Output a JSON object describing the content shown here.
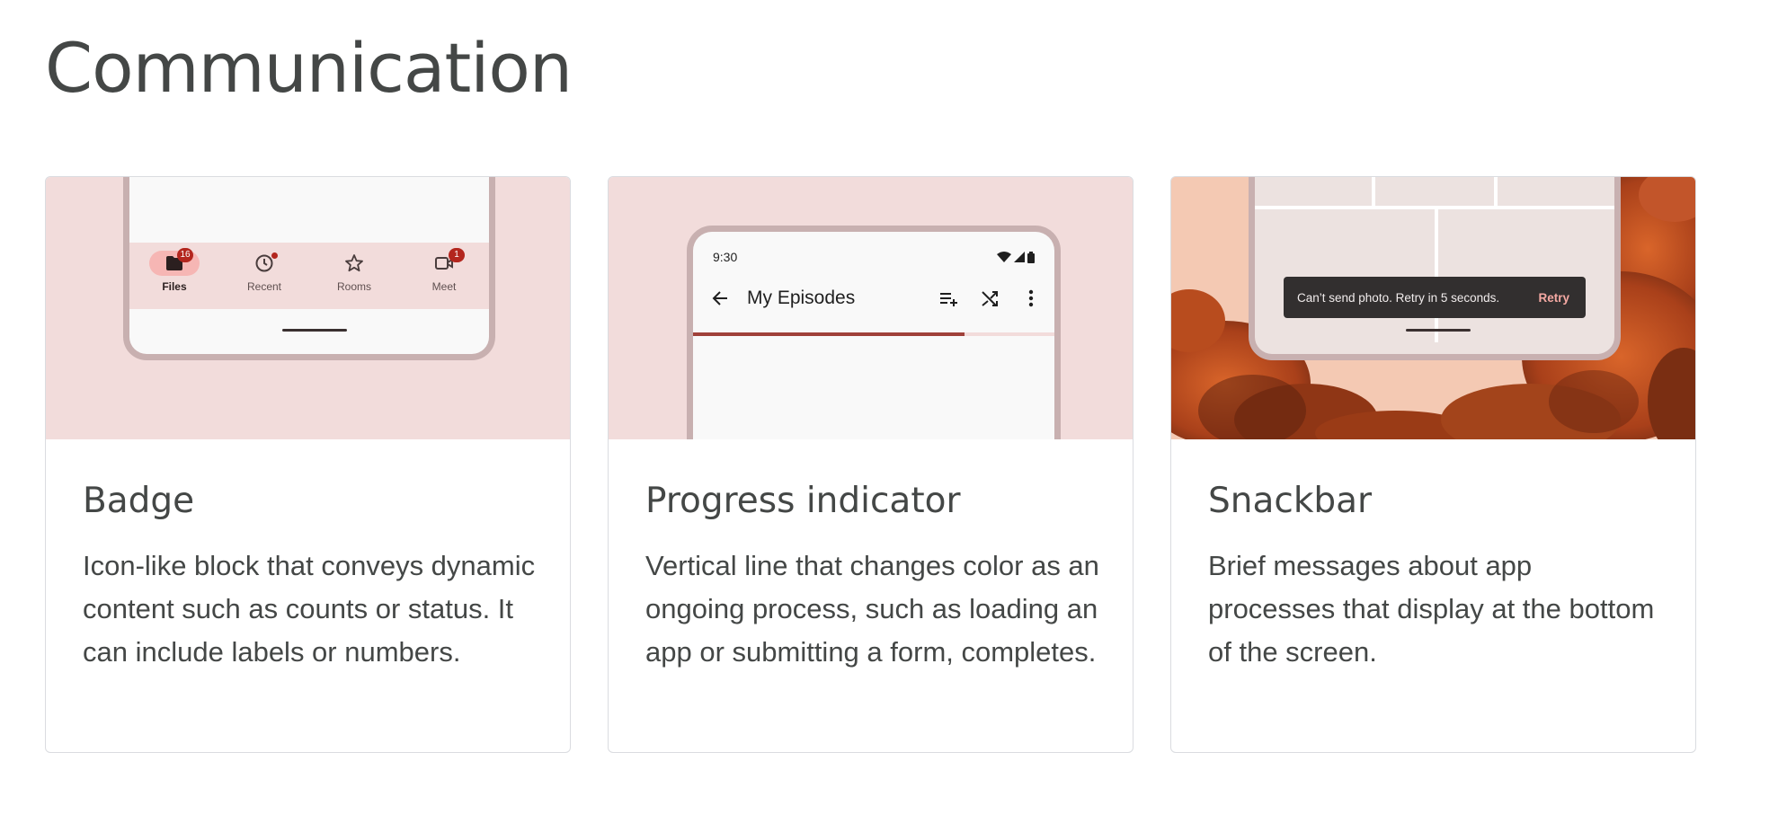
{
  "page": {
    "title": "Communication"
  },
  "colors": {
    "card_media_bg": "#f2dcdb",
    "badge_red": "#b3261e",
    "progress_fill": "#a0413a",
    "snackbar_bg": "#322f2f",
    "snackbar_action": "#f5a9a3"
  },
  "cards": [
    {
      "title": "Badge",
      "description": "Icon-like block that conveys dynamic content such as counts or status. It can include labels or numbers.",
      "preview": {
        "nav_items": [
          {
            "label": "Files",
            "icon": "folder-icon",
            "badge": "16",
            "active": true
          },
          {
            "label": "Recent",
            "icon": "clock-icon",
            "badge_dot": true
          },
          {
            "label": "Rooms",
            "icon": "star-icon"
          },
          {
            "label": "Meet",
            "icon": "video-icon",
            "badge": "1"
          }
        ]
      }
    },
    {
      "title": "Progress indicator",
      "description": "Vertical line that changes color as an ongoing process, such as loading an app or submitting a form, completes.",
      "preview": {
        "time": "9:30",
        "status_icons": [
          "wifi-icon",
          "signal-icon",
          "battery-icon"
        ],
        "app_title": "My Episodes",
        "actions": [
          "playlist-add-icon",
          "shuffle-icon",
          "more-vert-icon"
        ],
        "progress": 0.75
      }
    },
    {
      "title": "Snackbar",
      "description": "Brief messages about app processes that display at the bottom of the screen.",
      "preview": {
        "message": "Can’t send photo. Retry in 5 seconds.",
        "action": "Retry"
      }
    }
  ]
}
